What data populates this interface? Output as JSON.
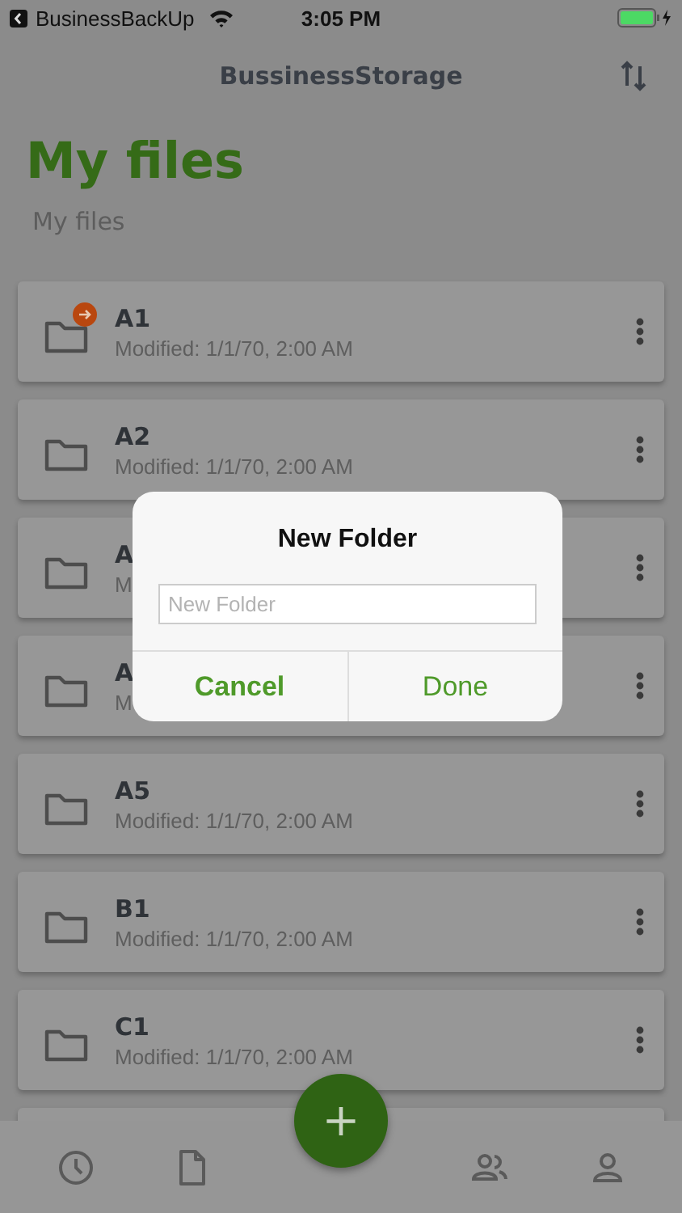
{
  "status_bar": {
    "back_app": "BusinessBackUp",
    "time": "3:05 PM"
  },
  "nav_bar": {
    "title": "BussinessStorage"
  },
  "header": {
    "title": "My files",
    "subtitle": "My files"
  },
  "folders": [
    {
      "name": "A1",
      "modified": "Modified: 1/1/70, 2:00 AM",
      "badge": true
    },
    {
      "name": "A2",
      "modified": "Modified: 1/1/70, 2:00 AM",
      "badge": false
    },
    {
      "name": "A",
      "modified": "M",
      "badge": false
    },
    {
      "name": "A",
      "modified": "M",
      "badge": false
    },
    {
      "name": "A5",
      "modified": "Modified: 1/1/70, 2:00 AM",
      "badge": false
    },
    {
      "name": "B1",
      "modified": "Modified: 1/1/70, 2:00 AM",
      "badge": false
    },
    {
      "name": "C1",
      "modified": "Modified: 1/1/70, 2:00 AM",
      "badge": false
    }
  ],
  "dialog": {
    "title": "New Folder",
    "placeholder": "New Folder",
    "buttons": [
      {
        "label": "Cancel",
        "kind": "cancel"
      },
      {
        "label": "Done",
        "kind": "confirm"
      }
    ]
  },
  "fab": {
    "label": "+"
  }
}
